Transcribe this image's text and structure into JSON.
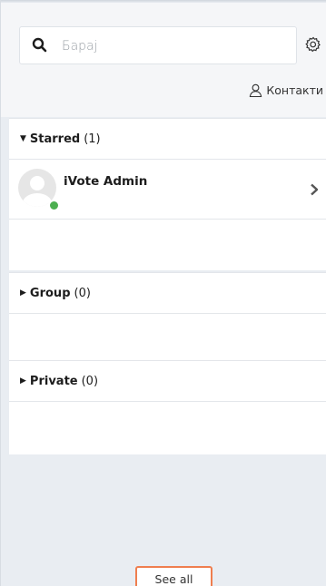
{
  "search": {
    "placeholder": "Барај"
  },
  "contacts_link": {
    "label": "Контакти"
  },
  "sections": {
    "starred": {
      "label": "Starred",
      "count": "(1)"
    },
    "group": {
      "label": "Group",
      "count": "(0)"
    },
    "private": {
      "label": "Private",
      "count": "(0)"
    }
  },
  "starred_contacts": [
    {
      "name": "iVote Admin",
      "status": "online"
    }
  ],
  "footer": {
    "see_all_label": "See all"
  },
  "colors": {
    "online_status": "#4caf50",
    "focus_outline": "#ef7e4f",
    "panel_background": "#e9edf2"
  },
  "icons": [
    "search-icon",
    "settings-icon",
    "user-icon",
    "chevron-right-icon",
    "caret-down-icon",
    "caret-right-icon"
  ]
}
